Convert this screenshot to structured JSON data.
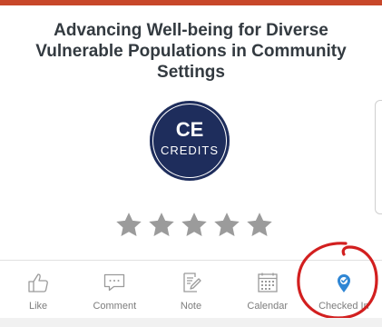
{
  "session": {
    "title": "Advancing Well-being for Diverse Vulnerable Populations in Community Settings"
  },
  "badge": {
    "line1": "CE",
    "line2": "CREDITS",
    "color": "#1e2d5c"
  },
  "rating": {
    "stars_total": 5,
    "stars_filled": 0,
    "star_color": "#9b9b9b"
  },
  "actions": [
    {
      "label": "Like",
      "icon": "thumbs-up-icon"
    },
    {
      "label": "Comment",
      "icon": "comment-icon"
    },
    {
      "label": "Note",
      "icon": "note-icon"
    },
    {
      "label": "Calendar",
      "icon": "calendar-icon"
    },
    {
      "label": "Checked In",
      "icon": "checked-in-location-icon",
      "active_color": "#2f86d4"
    }
  ],
  "annotation_color": "#d21f1f"
}
